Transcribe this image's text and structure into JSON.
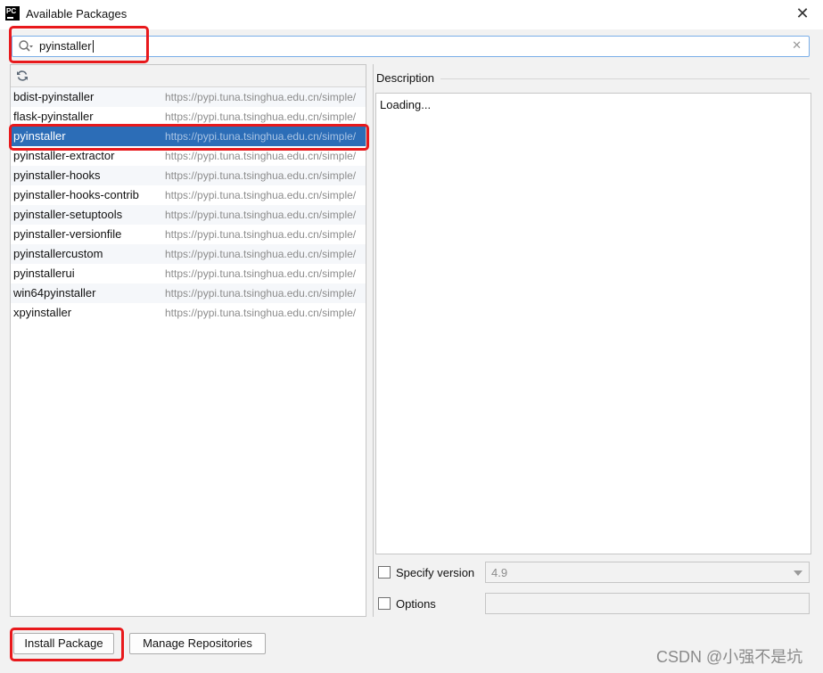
{
  "window": {
    "app_icon_text": "PC",
    "title": "Available Packages",
    "close_symbol": "✕"
  },
  "search": {
    "value": "pyinstaller",
    "clear_symbol": "✕",
    "search_icon": "search-icon"
  },
  "toolbar": {
    "refresh_icon": "refresh-icon"
  },
  "packages": [
    {
      "name": "bdist-pyinstaller",
      "repo": "https://pypi.tuna.tsinghua.edu.cn/simple/"
    },
    {
      "name": "flask-pyinstaller",
      "repo": "https://pypi.tuna.tsinghua.edu.cn/simple/"
    },
    {
      "name": "pyinstaller",
      "repo": "https://pypi.tuna.tsinghua.edu.cn/simple/",
      "selected": true
    },
    {
      "name": "pyinstaller-extractor",
      "repo": "https://pypi.tuna.tsinghua.edu.cn/simple/"
    },
    {
      "name": "pyinstaller-hooks",
      "repo": "https://pypi.tuna.tsinghua.edu.cn/simple/"
    },
    {
      "name": "pyinstaller-hooks-contrib",
      "repo": "https://pypi.tuna.tsinghua.edu.cn/simple/"
    },
    {
      "name": "pyinstaller-setuptools",
      "repo": "https://pypi.tuna.tsinghua.edu.cn/simple/"
    },
    {
      "name": "pyinstaller-versionfile",
      "repo": "https://pypi.tuna.tsinghua.edu.cn/simple/"
    },
    {
      "name": "pyinstallercustom",
      "repo": "https://pypi.tuna.tsinghua.edu.cn/simple/"
    },
    {
      "name": "pyinstallerui",
      "repo": "https://pypi.tuna.tsinghua.edu.cn/simple/"
    },
    {
      "name": "win64pyinstaller",
      "repo": "https://pypi.tuna.tsinghua.edu.cn/simple/"
    },
    {
      "name": "xpyinstaller",
      "repo": "https://pypi.tuna.tsinghua.edu.cn/simple/"
    }
  ],
  "description": {
    "label": "Description",
    "content": "Loading..."
  },
  "options": {
    "specify_version_label": "Specify version",
    "specify_version_checked": false,
    "version_value": "4.9",
    "options_label": "Options",
    "options_checked": false,
    "options_value": ""
  },
  "buttons": {
    "install": "Install Package",
    "manage_repos": "Manage Repositories"
  },
  "watermark": "CSDN @小强不是坑",
  "colors": {
    "selection": "#2c6db7",
    "highlight_box": "#e8191c",
    "focus_border": "#7aaee8"
  }
}
